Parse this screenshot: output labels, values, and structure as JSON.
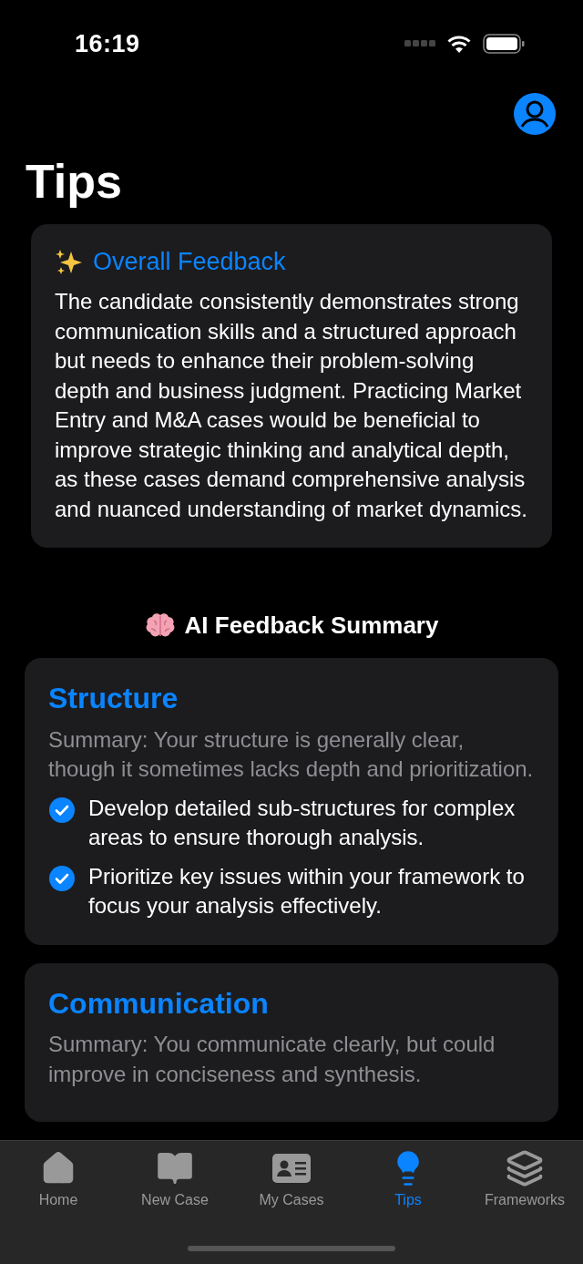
{
  "status_bar": {
    "time": "16:19"
  },
  "header": {
    "title": "Tips"
  },
  "overall_feedback": {
    "title": "Overall Feedback",
    "body": "The candidate consistently demonstrates strong communication skills and a structured approach but needs to enhance their problem-solving depth and business judgment. Practicing Market Entry and M&A cases would be beneficial to improve strategic thinking and analytical depth, as these cases demand comprehensive analysis and nuanced understanding of market dynamics."
  },
  "summary_section": {
    "title": "AI Feedback Summary"
  },
  "categories": [
    {
      "title": "Structure",
      "summary": "Summary: Your structure is generally clear, though it sometimes lacks depth and prioritization.",
      "points": [
        "Develop detailed sub-structures for complex areas to ensure thorough analysis.",
        "Prioritize key issues within your framework to focus your analysis effectively."
      ]
    },
    {
      "title": "Communication",
      "summary": "Summary: You communicate clearly, but could improve in conciseness and synthesis."
    }
  ],
  "tabs": [
    {
      "label": "Home",
      "selected": false
    },
    {
      "label": "New Case",
      "selected": false
    },
    {
      "label": "My Cases",
      "selected": false
    },
    {
      "label": "Tips",
      "selected": true
    },
    {
      "label": "Frameworks",
      "selected": false
    }
  ]
}
